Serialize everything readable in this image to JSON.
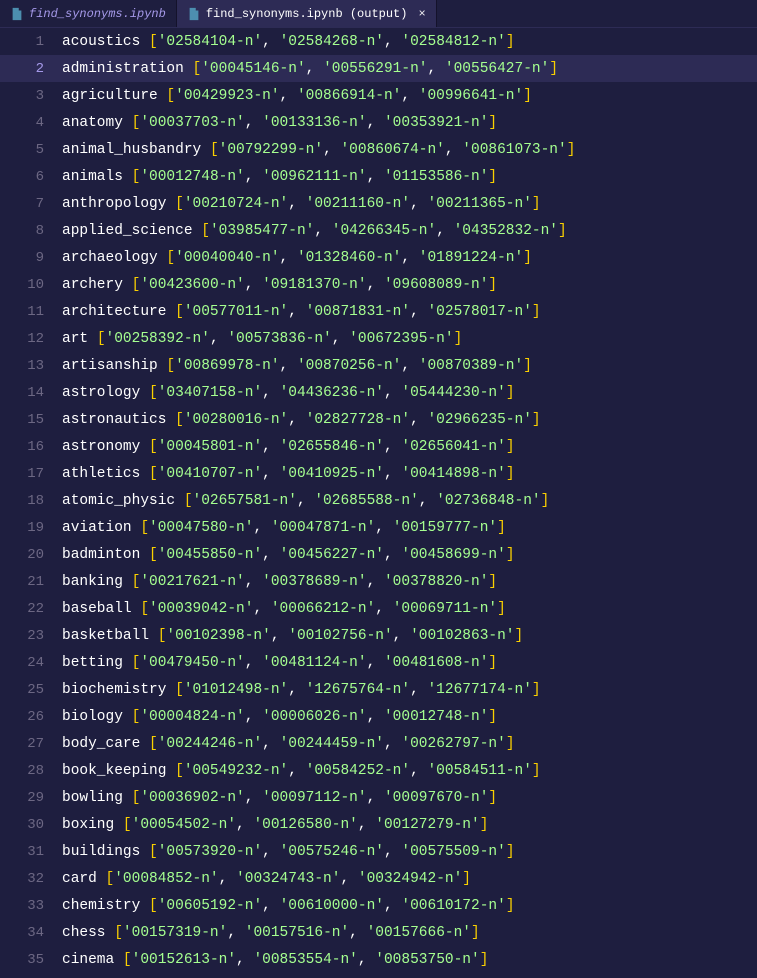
{
  "tabs": [
    {
      "label": "find_synonyms.ipynb",
      "active": false,
      "closeable": false
    },
    {
      "label": "find_synonyms.ipynb (output)",
      "active": true,
      "closeable": true
    }
  ],
  "highlighted_line": 2,
  "lines": [
    {
      "num": 1,
      "key": "acoustics",
      "ids": [
        "02584104-n",
        "02584268-n",
        "02584812-n"
      ]
    },
    {
      "num": 2,
      "key": "administration",
      "ids": [
        "00045146-n",
        "00556291-n",
        "00556427-n"
      ]
    },
    {
      "num": 3,
      "key": "agriculture",
      "ids": [
        "00429923-n",
        "00866914-n",
        "00996641-n"
      ]
    },
    {
      "num": 4,
      "key": "anatomy",
      "ids": [
        "00037703-n",
        "00133136-n",
        "00353921-n"
      ]
    },
    {
      "num": 5,
      "key": "animal_husbandry",
      "ids": [
        "00792299-n",
        "00860674-n",
        "00861073-n"
      ]
    },
    {
      "num": 6,
      "key": "animals",
      "ids": [
        "00012748-n",
        "00962111-n",
        "01153586-n"
      ]
    },
    {
      "num": 7,
      "key": "anthropology",
      "ids": [
        "00210724-n",
        "00211160-n",
        "00211365-n"
      ]
    },
    {
      "num": 8,
      "key": "applied_science",
      "ids": [
        "03985477-n",
        "04266345-n",
        "04352832-n"
      ]
    },
    {
      "num": 9,
      "key": "archaeology",
      "ids": [
        "00040040-n",
        "01328460-n",
        "01891224-n"
      ]
    },
    {
      "num": 10,
      "key": "archery",
      "ids": [
        "00423600-n",
        "09181370-n",
        "09608089-n"
      ]
    },
    {
      "num": 11,
      "key": "architecture",
      "ids": [
        "00577011-n",
        "00871831-n",
        "02578017-n"
      ]
    },
    {
      "num": 12,
      "key": "art",
      "ids": [
        "00258392-n",
        "00573836-n",
        "00672395-n"
      ]
    },
    {
      "num": 13,
      "key": "artisanship",
      "ids": [
        "00869978-n",
        "00870256-n",
        "00870389-n"
      ]
    },
    {
      "num": 14,
      "key": "astrology",
      "ids": [
        "03407158-n",
        "04436236-n",
        "05444230-n"
      ]
    },
    {
      "num": 15,
      "key": "astronautics",
      "ids": [
        "00280016-n",
        "02827728-n",
        "02966235-n"
      ]
    },
    {
      "num": 16,
      "key": "astronomy",
      "ids": [
        "00045801-n",
        "02655846-n",
        "02656041-n"
      ]
    },
    {
      "num": 17,
      "key": "athletics",
      "ids": [
        "00410707-n",
        "00410925-n",
        "00414898-n"
      ]
    },
    {
      "num": 18,
      "key": "atomic_physic",
      "ids": [
        "02657581-n",
        "02685588-n",
        "02736848-n"
      ]
    },
    {
      "num": 19,
      "key": "aviation",
      "ids": [
        "00047580-n",
        "00047871-n",
        "00159777-n"
      ]
    },
    {
      "num": 20,
      "key": "badminton",
      "ids": [
        "00455850-n",
        "00456227-n",
        "00458699-n"
      ]
    },
    {
      "num": 21,
      "key": "banking",
      "ids": [
        "00217621-n",
        "00378689-n",
        "00378820-n"
      ]
    },
    {
      "num": 22,
      "key": "baseball",
      "ids": [
        "00039042-n",
        "00066212-n",
        "00069711-n"
      ]
    },
    {
      "num": 23,
      "key": "basketball",
      "ids": [
        "00102398-n",
        "00102756-n",
        "00102863-n"
      ]
    },
    {
      "num": 24,
      "key": "betting",
      "ids": [
        "00479450-n",
        "00481124-n",
        "00481608-n"
      ]
    },
    {
      "num": 25,
      "key": "biochemistry",
      "ids": [
        "01012498-n",
        "12675764-n",
        "12677174-n"
      ]
    },
    {
      "num": 26,
      "key": "biology",
      "ids": [
        "00004824-n",
        "00006026-n",
        "00012748-n"
      ]
    },
    {
      "num": 27,
      "key": "body_care",
      "ids": [
        "00244246-n",
        "00244459-n",
        "00262797-n"
      ]
    },
    {
      "num": 28,
      "key": "book_keeping",
      "ids": [
        "00549232-n",
        "00584252-n",
        "00584511-n"
      ]
    },
    {
      "num": 29,
      "key": "bowling",
      "ids": [
        "00036902-n",
        "00097112-n",
        "00097670-n"
      ]
    },
    {
      "num": 30,
      "key": "boxing",
      "ids": [
        "00054502-n",
        "00126580-n",
        "00127279-n"
      ]
    },
    {
      "num": 31,
      "key": "buildings",
      "ids": [
        "00573920-n",
        "00575246-n",
        "00575509-n"
      ]
    },
    {
      "num": 32,
      "key": "card",
      "ids": [
        "00084852-n",
        "00324743-n",
        "00324942-n"
      ]
    },
    {
      "num": 33,
      "key": "chemistry",
      "ids": [
        "00605192-n",
        "00610000-n",
        "00610172-n"
      ]
    },
    {
      "num": 34,
      "key": "chess",
      "ids": [
        "00157319-n",
        "00157516-n",
        "00157666-n"
      ]
    },
    {
      "num": 35,
      "key": "cinema",
      "ids": [
        "00152613-n",
        "00853554-n",
        "00853750-n"
      ]
    }
  ]
}
